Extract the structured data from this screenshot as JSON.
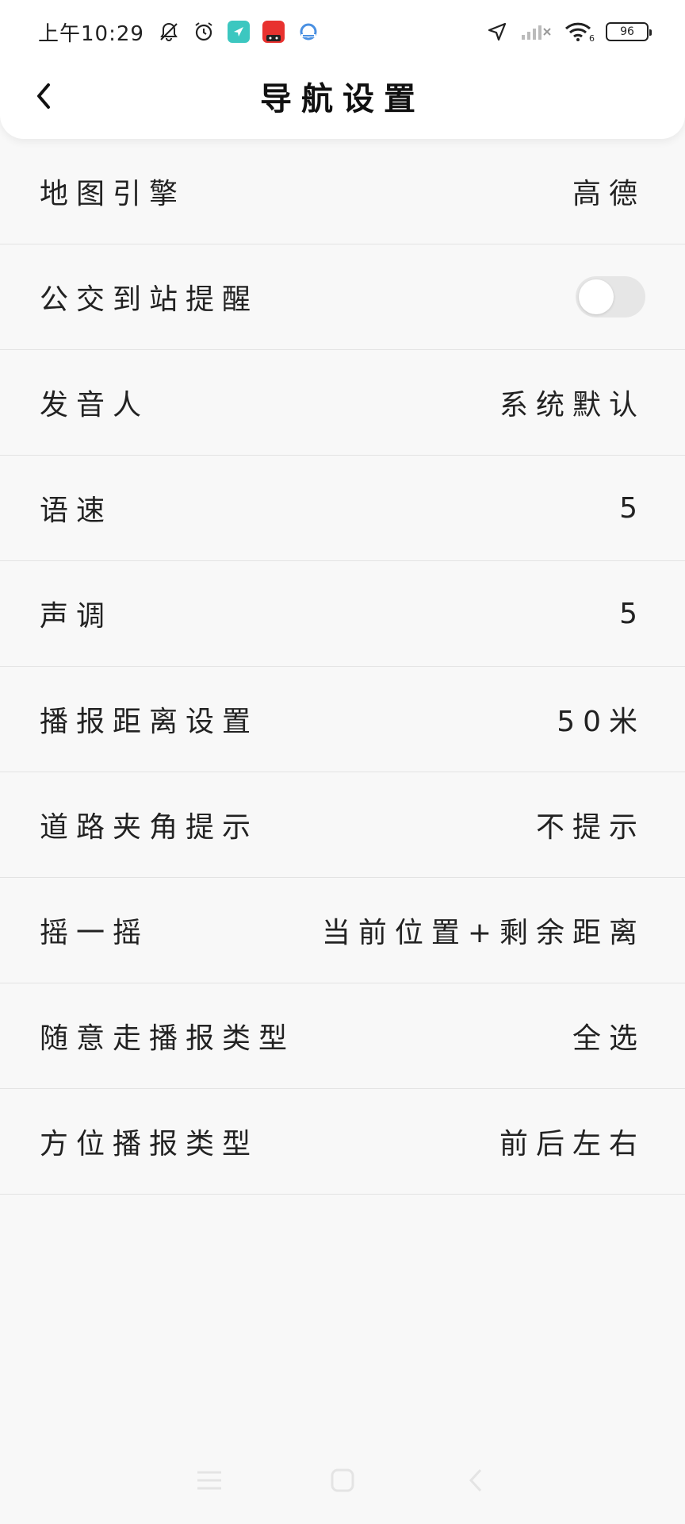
{
  "status_bar": {
    "time": "上午10:29",
    "battery": "96",
    "signal_label": "6"
  },
  "header": {
    "title": "导航设置"
  },
  "settings": [
    {
      "label": "地图引擎",
      "value": "高德"
    },
    {
      "label": "公交到站提醒",
      "toggle": false
    },
    {
      "label": "发音人",
      "value": "系统默认"
    },
    {
      "label": "语速",
      "value": "5"
    },
    {
      "label": "声调",
      "value": "5"
    },
    {
      "label": "播报距离设置",
      "value": "50米"
    },
    {
      "label": "道路夹角提示",
      "value": "不提示"
    },
    {
      "label": "摇一摇",
      "value": "当前位置+剩余距离"
    },
    {
      "label": "随意走播报类型",
      "value": "全选"
    },
    {
      "label": "方位播报类型",
      "value": "前后左右"
    }
  ],
  "colors": {
    "background": "#f8f8f8",
    "header_bg": "#ffffff",
    "text": "#222222",
    "toggle_off": "#e6e6e6",
    "app_icon_teal": "#3cc7c0",
    "app_icon_red": "#e8322f"
  }
}
